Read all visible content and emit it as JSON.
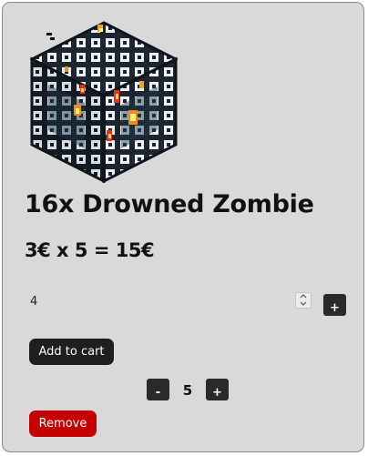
{
  "product": {
    "title": "16x Drowned Zombie",
    "price_line": "3€ x 5 = 15€",
    "image_icon": "mob-spawner-cube-icon"
  },
  "quantity_input": {
    "value": "4"
  },
  "stepper": {
    "minus_label": "-",
    "value": "5",
    "plus_label": "+"
  },
  "increment_button_label": "+",
  "actions": {
    "add_to_cart_label": "Add to cart",
    "remove_label": "Remove"
  },
  "colors": {
    "card_background": "#d9d9d9",
    "dark_button": "#2a2a2a",
    "add_to_cart_button": "#1f1f1f",
    "remove_button": "#c40000"
  }
}
